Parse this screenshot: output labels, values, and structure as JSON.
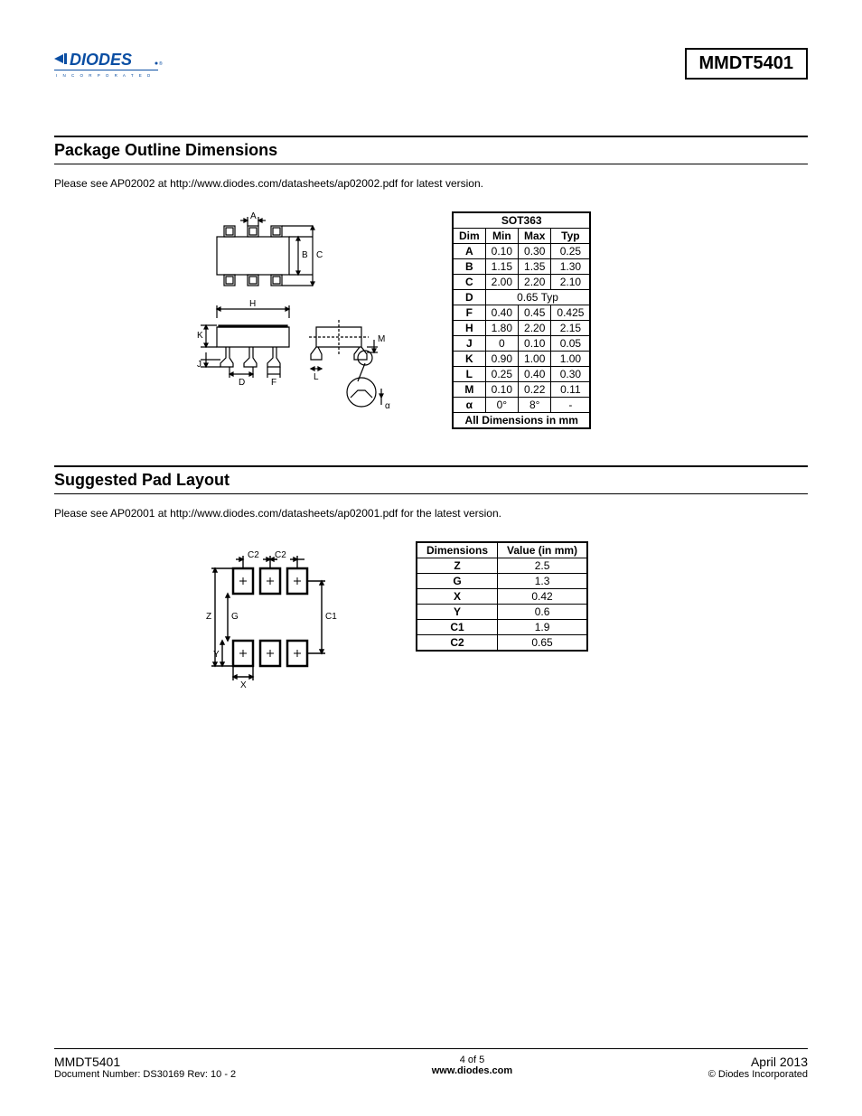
{
  "header": {
    "logo_text": "DIODES",
    "logo_sub": "INCORPORATED",
    "part_number": "MMDT5401"
  },
  "section1": {
    "title": "Package Outline Dimensions",
    "note": "Please see AP02002 at http://www.diodes.com/datasheets/ap02002.pdf for latest version.",
    "table_title": "SOT363",
    "headers": [
      "Dim",
      "Min",
      "Max",
      "Typ"
    ],
    "rows": [
      {
        "dim": "A",
        "min": "0.10",
        "max": "0.30",
        "typ": "0.25"
      },
      {
        "dim": "B",
        "min": "1.15",
        "max": "1.35",
        "typ": "1.30"
      },
      {
        "dim": "C",
        "min": "2.00",
        "max": "2.20",
        "typ": "2.10"
      },
      {
        "dim": "D",
        "span": "0.65 Typ"
      },
      {
        "dim": "F",
        "min": "0.40",
        "max": "0.45",
        "typ": "0.425"
      },
      {
        "dim": "H",
        "min": "1.80",
        "max": "2.20",
        "typ": "2.15"
      },
      {
        "dim": "J",
        "min": "0",
        "max": "0.10",
        "typ": "0.05"
      },
      {
        "dim": "K",
        "min": "0.90",
        "max": "1.00",
        "typ": "1.00"
      },
      {
        "dim": "L",
        "min": "0.25",
        "max": "0.40",
        "typ": "0.30"
      },
      {
        "dim": "M",
        "min": "0.10",
        "max": "0.22",
        "typ": "0.11"
      },
      {
        "dim": "α",
        "min": "0°",
        "max": "8°",
        "typ": "-"
      }
    ],
    "footer": "All Dimensions in mm",
    "drawing_labels": {
      "A": "A",
      "B": "B",
      "C": "C",
      "D": "D",
      "F": "F",
      "H": "H",
      "J": "J",
      "K": "K",
      "L": "L",
      "M": "M",
      "alpha": "α"
    }
  },
  "section2": {
    "title": "Suggested Pad Layout",
    "note": "Please see AP02001 at http://www.diodes.com/datasheets/ap02001.pdf for the latest version.",
    "headers": [
      "Dimensions",
      "Value (in mm)"
    ],
    "rows": [
      {
        "dim": "Z",
        "val": "2.5"
      },
      {
        "dim": "G",
        "val": "1.3"
      },
      {
        "dim": "X",
        "val": "0.42"
      },
      {
        "dim": "Y",
        "val": "0.6"
      },
      {
        "dim": "C1",
        "val": "1.9"
      },
      {
        "dim": "C2",
        "val": "0.65"
      }
    ],
    "drawing_labels": {
      "Z": "Z",
      "G": "G",
      "X": "X",
      "Y": "Y",
      "C1": "C1",
      "C2": "C2"
    }
  },
  "footer": {
    "left_part": "MMDT5401",
    "left_doc": "Document Number: DS30169 Rev: 10 - 2",
    "center_page": "4 of 5",
    "center_url": "www.diodes.com",
    "right_date": "April 2013",
    "right_copy": "© Diodes Incorporated"
  }
}
